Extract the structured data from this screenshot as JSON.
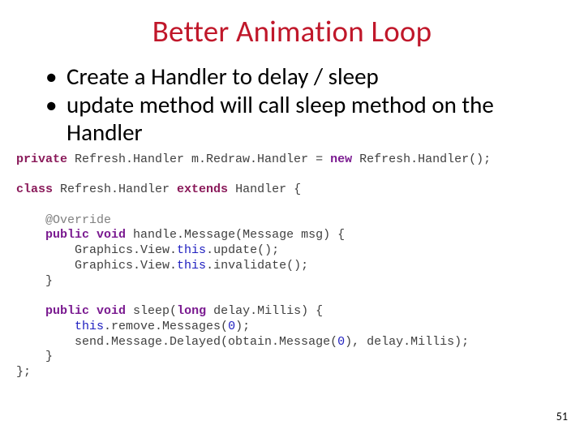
{
  "title": "Better Animation Loop",
  "bullets": [
    "Create a Handler to delay / sleep",
    "update method will call sleep method on the Handler"
  ],
  "code": {
    "t_private": "private",
    "t_field_decl": " Refresh.Handler m.Redraw.Handler = ",
    "t_new": "new",
    "t_field_end": " Refresh.Handler();",
    "t_class": "class",
    "t_classname": " Refresh.Handler ",
    "t_extends": "extends",
    "t_super": " Handler {",
    "t_override": "@Override",
    "t_public1": "public",
    "t_void1": " void",
    "t_hm_sig": " handle.Message(Message msg) {",
    "t_gv": "Graphics.View.",
    "t_this": "this",
    "t_update": ".update();",
    "t_invalidate": ".invalidate();",
    "t_close1": "}",
    "t_public2": "public",
    "t_void2": " void",
    "t_sleep": " sleep(",
    "t_long": "long",
    "t_sleep_arg": " delay.Millis) {",
    "t_remove": ".remove.Messages(",
    "t_zero": "0",
    "t_paren_semi": ");",
    "t_send": "send.Message.Delayed(obtain.Message(",
    "t_send_tail": "), delay.Millis);",
    "t_close2": "}",
    "t_close_class": "};"
  },
  "page_number": "51"
}
